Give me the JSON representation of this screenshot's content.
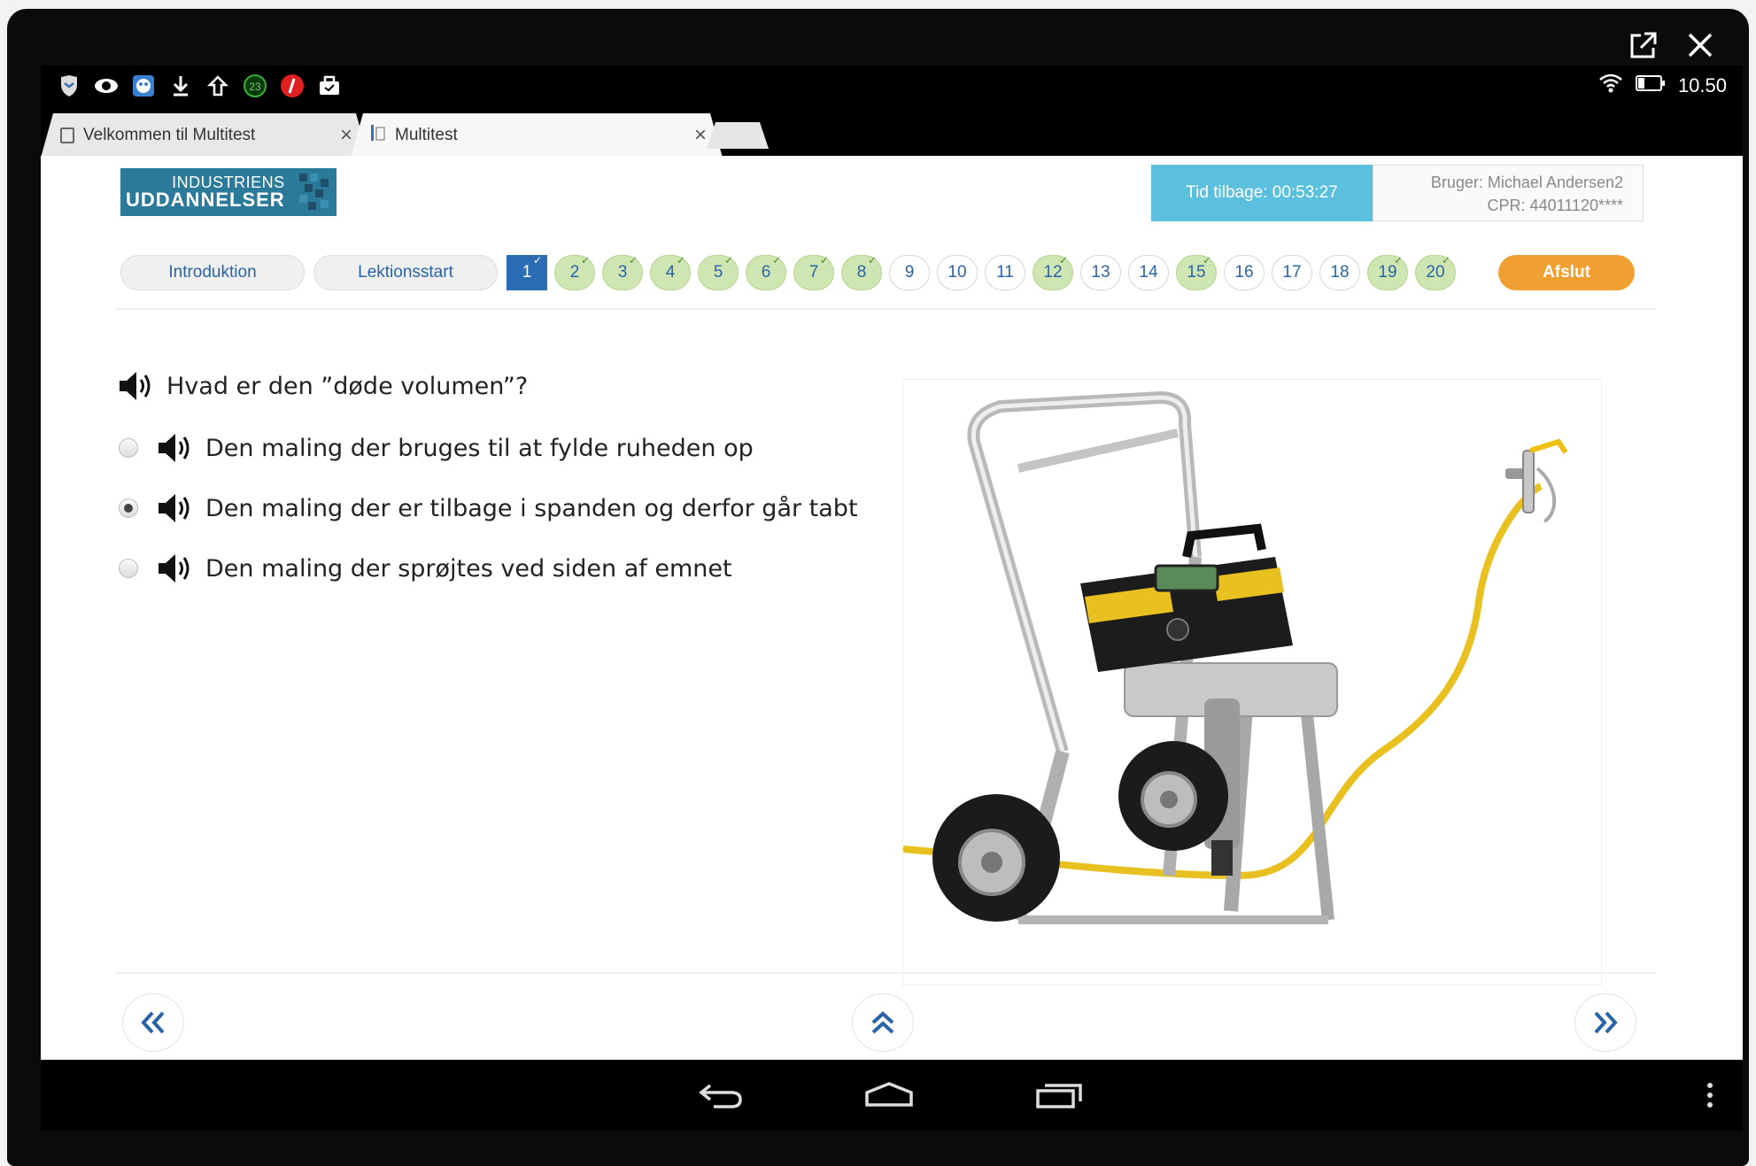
{
  "window": {
    "controls": [
      "popout-icon",
      "close-icon"
    ]
  },
  "statusbar": {
    "icons": [
      "shield-icon",
      "eye-icon",
      "mascot-icon",
      "download-icon",
      "upload-icon",
      "notification-count-icon",
      "red-l-icon",
      "briefcase-icon"
    ],
    "notification_count": "23",
    "time": "10.50"
  },
  "browser": {
    "tabs": [
      {
        "title": "Velkommen til Multitest",
        "active": false
      },
      {
        "title": "Multitest",
        "active": true
      }
    ]
  },
  "header": {
    "logo": {
      "line1": "INDUSTRIENS",
      "line2": "UDDANNELSER"
    },
    "timer": "Tid tilbage: 00:53:27",
    "user": "Bruger: Michael Andersen2",
    "cpr": "CPR: 44011120****"
  },
  "nav": {
    "introduction": "Introduktion",
    "lesson_start": "Lektionsstart",
    "questions": [
      {
        "n": "1",
        "state": "current"
      },
      {
        "n": "2",
        "state": "done"
      },
      {
        "n": "3",
        "state": "done"
      },
      {
        "n": "4",
        "state": "done"
      },
      {
        "n": "5",
        "state": "done"
      },
      {
        "n": "6",
        "state": "done"
      },
      {
        "n": "7",
        "state": "done"
      },
      {
        "n": "8",
        "state": "done"
      },
      {
        "n": "9",
        "state": "open"
      },
      {
        "n": "10",
        "state": "open"
      },
      {
        "n": "11",
        "state": "open"
      },
      {
        "n": "12",
        "state": "done"
      },
      {
        "n": "13",
        "state": "open"
      },
      {
        "n": "14",
        "state": "open"
      },
      {
        "n": "15",
        "state": "done"
      },
      {
        "n": "16",
        "state": "open"
      },
      {
        "n": "17",
        "state": "open"
      },
      {
        "n": "18",
        "state": "open"
      },
      {
        "n": "19",
        "state": "done"
      },
      {
        "n": "20",
        "state": "done"
      }
    ],
    "finish": "Afslut"
  },
  "question": {
    "text": "Hvad er den ”døde volumen”?",
    "options": [
      {
        "text": "Den maling der bruges til at fylde ruheden op",
        "selected": false
      },
      {
        "text": "Den maling der er tilbage i spanden og derfor går tabt",
        "selected": true
      },
      {
        "text": "Den maling der sprøjtes ved siden af emnet",
        "selected": false
      }
    ]
  },
  "colors": {
    "timer_bg": "#5bc0de",
    "finish_bg": "#f0a030",
    "current_q": "#2a6db5",
    "done_q": "#cfe6b3",
    "accent_blue": "#2a64a8"
  },
  "footer_nav": [
    "double-chevron-left-icon",
    "double-chevron-up-icon",
    "double-chevron-right-icon"
  ],
  "android_nav": [
    "back-icon",
    "home-icon",
    "recents-icon",
    "menu-dots-icon"
  ]
}
